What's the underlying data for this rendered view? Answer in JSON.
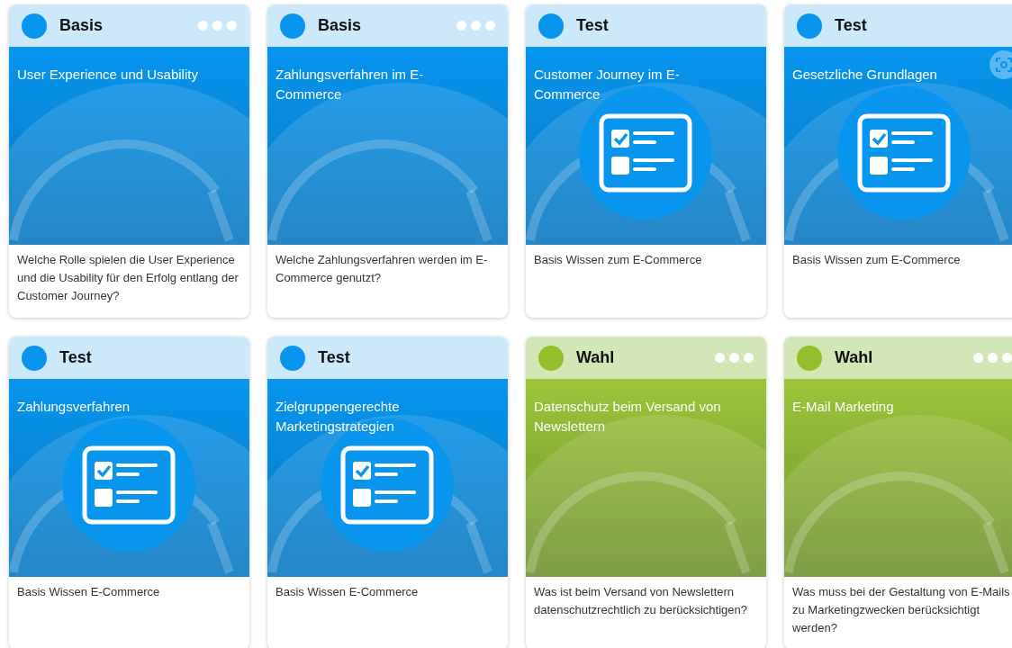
{
  "cards": [
    {
      "tag": "Basis",
      "color": "#0895ee",
      "has_menu": true,
      "checklist": false,
      "scan_button": false,
      "title": "User Experience und Usability",
      "description": "Welche Rolle spielen die User Experience und die Usability für den Erfolg entlang der Customer Journey?"
    },
    {
      "tag": "Basis",
      "color": "#0895ee",
      "has_menu": true,
      "checklist": false,
      "scan_button": false,
      "title": "Zahlungsverfahren im E-Commerce",
      "description": "Welche Zahlungsverfahren werden im E-Commerce genutzt?"
    },
    {
      "tag": "Test",
      "color": "#0895ee",
      "has_menu": false,
      "checklist": true,
      "scan_button": false,
      "title": "Customer Journey im E-Commerce",
      "description": "Basis Wissen zum E-Commerce"
    },
    {
      "tag": "Test",
      "color": "#0895ee",
      "has_menu": false,
      "checklist": true,
      "scan_button": true,
      "title": "Gesetzliche Grundlagen",
      "description": "Basis Wissen zum E-Commerce"
    },
    {
      "tag": "Test",
      "color": "#0895ee",
      "has_menu": false,
      "checklist": true,
      "scan_button": false,
      "title": "Zahlungsverfahren",
      "description": "Basis Wissen E-Commerce"
    },
    {
      "tag": "Test",
      "color": "#0895ee",
      "has_menu": false,
      "checklist": true,
      "scan_button": false,
      "title": "Zielgruppengerechte Marketingstrategien",
      "description": "Basis Wissen E-Commerce"
    },
    {
      "tag": "Wahl",
      "color": "#93bf2c",
      "has_menu": true,
      "checklist": false,
      "scan_button": false,
      "title": "Datenschutz beim Versand von Newslettern",
      "description": "Was ist beim Versand von Newslettern datenschutzrechtlich zu berücksichtigen?"
    },
    {
      "tag": "Wahl",
      "color": "#93bf2c",
      "has_menu": true,
      "checklist": false,
      "scan_button": false,
      "title": "E-Mail Marketing",
      "description": "Was muss bei der Gestaltung von E-Mails zu Marketingzwecken berücksichtigt werden?"
    }
  ]
}
